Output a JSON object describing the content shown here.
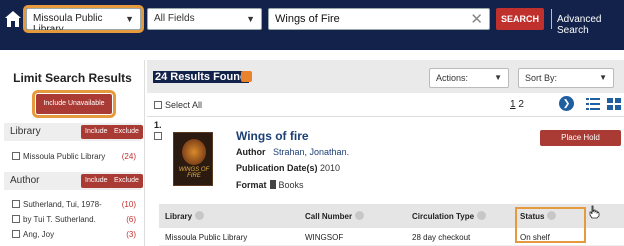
{
  "header": {
    "library_select": "Missoula Public Library",
    "field_select": "All Fields",
    "search_value": "Wings of Fire",
    "search_button": "SEARCH",
    "advanced": "Advanced Search"
  },
  "sidebar": {
    "title": "Limit Search Results",
    "include_unavailable": "Include Unavailable",
    "facets": [
      {
        "title": "Library",
        "include": "Include",
        "exclude": "Exclude",
        "items": [
          {
            "label": "Missoula Public Library",
            "count": "(24)"
          }
        ]
      },
      {
        "title": "Author",
        "include": "Include",
        "exclude": "Exclude",
        "items": [
          {
            "label": "Sutherland, Tui, 1978-",
            "count": "(10)"
          },
          {
            "label": "by Tui T. Sutherland.",
            "count": "(6)"
          },
          {
            "label": "Ang, Joy",
            "count": "(3)"
          }
        ]
      }
    ]
  },
  "results": {
    "count_label": "24 Results Found",
    "actions": "Actions:",
    "sort_by": "Sort By:",
    "select_all": "Select All",
    "pages": [
      "1",
      "2"
    ],
    "item": {
      "number": "1.",
      "title": "Wings of fire",
      "author_label": "Author",
      "author": "Strahan, Jonathan.",
      "pubdate_label": "Publication Date(s)",
      "pubdate": "2010",
      "format_label": "Format",
      "format": "Books",
      "hold": "Place Hold",
      "cover_text": "WINGS OF FIRE"
    },
    "table": {
      "headers": [
        "Library",
        "Call Number",
        "Circulation Type",
        "Status"
      ],
      "row": [
        "Missoula Public Library",
        "WINGSOF",
        "28 day checkout",
        "On shelf"
      ]
    }
  },
  "colors": {
    "navy": "#12224a",
    "brand_red": "#a93a34",
    "highlight": "#e59a3e"
  }
}
